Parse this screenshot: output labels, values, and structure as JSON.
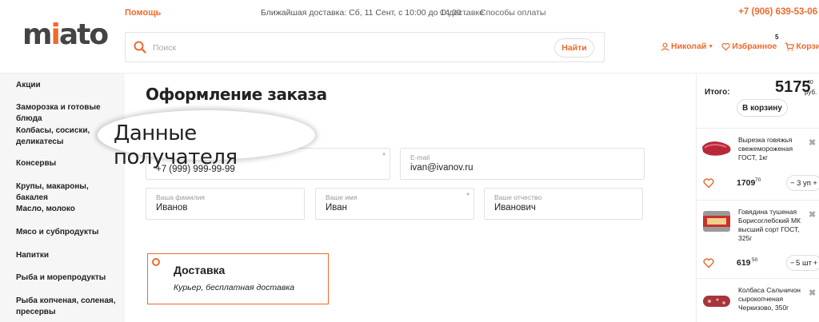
{
  "header": {
    "help": "Помощь",
    "nearest_delivery": "Ближайшая доставка: Сб, 11 Сент, с 10:00 до 14:00",
    "about_delivery": "О доставке",
    "payment_methods": "Способы оплаты",
    "phone_code": "+7 (906)",
    "phone_number": "639-53-06",
    "logo_text_pre": "m",
    "logo_text_i": "i",
    "logo_text_post": "ato"
  },
  "search": {
    "placeholder": "Поиск",
    "button": "Найти"
  },
  "user": {
    "name": "Николай",
    "favorites": "Избранное",
    "cart": "Корзина",
    "cart_count": "5"
  },
  "sidebar": {
    "items": [
      "Акции",
      "Заморозка и готовые блюда",
      "Колбасы, сосиски, деликатесы",
      "Консервы",
      "Крупы, макароны, бакалея",
      "Масло, молоко",
      "Мясо и субпродукты",
      "Напитки",
      "Рыба и морепродукты",
      "Рыба копченая, соленая, пресервы"
    ]
  },
  "main": {
    "title": "Оформление заказа",
    "recipient_heading": "Данные получателя",
    "phone_value": "+7 (999) 999-99-99",
    "email_label": "E-mail",
    "email_value": "ivan@ivanov.ru",
    "lastname_label": "Ваша фамилия",
    "lastname_value": "Иванов",
    "firstname_label": "Ваше имя",
    "firstname_value": "Иван",
    "patronymic_label": "Ваше отчество",
    "patronymic_value": "Иванович",
    "required_mark": "*"
  },
  "delivery": {
    "title": "Доставка",
    "subtitle": "Курьер, бесплатная доставка"
  },
  "summary": {
    "total_label": "Итого:",
    "total_value": "5175",
    "total_kop": "40",
    "currency": "руб.",
    "to_cart": "В корзину"
  },
  "cart_items": [
    {
      "name": "Вырезка говяжья свежемороженая ГОСТ, 1кг",
      "price": "1709",
      "kop": "70",
      "qty": "3 уп"
    },
    {
      "name": "Говядина тушеная Борисоглебский МК высший сорт ГОСТ, 325г",
      "price": "619",
      "kop": "50",
      "qty": "5 шт"
    },
    {
      "name": "Колбаса Сальчичон сырокопченая Черкизово, 350г",
      "price": "",
      "kop": "",
      "qty": ""
    }
  ],
  "colors": {
    "accent": "#ef6a2c",
    "sidebar_bg": "#f6f6f6",
    "border": "#e2e2e2"
  }
}
